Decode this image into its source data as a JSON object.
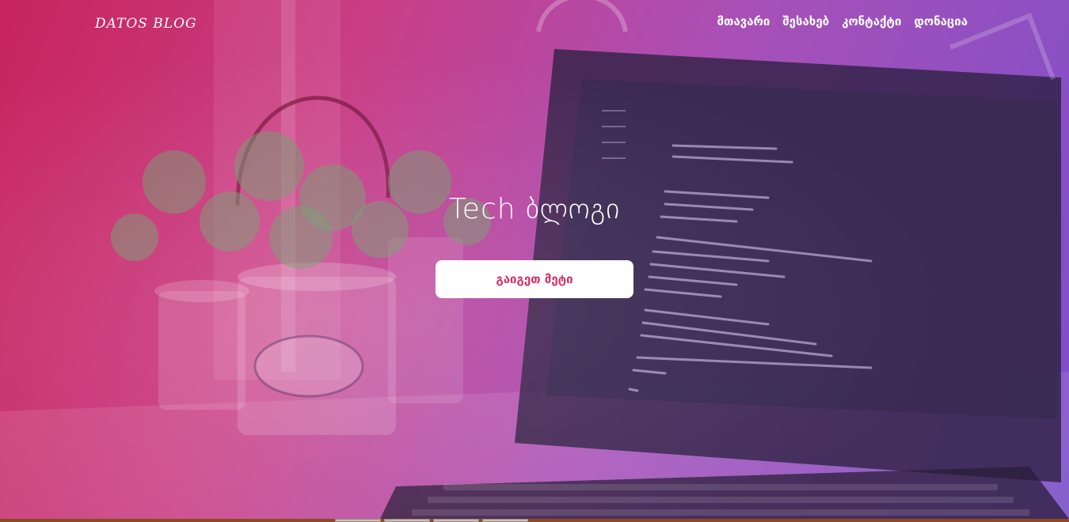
{
  "brand": {
    "text": "DATOS BLOG"
  },
  "nav": {
    "items": [
      {
        "label": "მთავარი"
      },
      {
        "label": "შესახებ"
      },
      {
        "label": "კონტაქტი"
      },
      {
        "label": "დონაცია"
      }
    ]
  },
  "hero": {
    "title": "Tech ბლოგი",
    "cta_label": "გაიგეთ მეტი",
    "background": "laptop-and-plants-photo",
    "gradient_colors": [
      "#c8245c",
      "#c93e86",
      "#a850b8",
      "#7a4fc9"
    ]
  },
  "colors": {
    "accent": "#d0245c",
    "button_bg": "#ffffff",
    "text": "#ffffff"
  }
}
